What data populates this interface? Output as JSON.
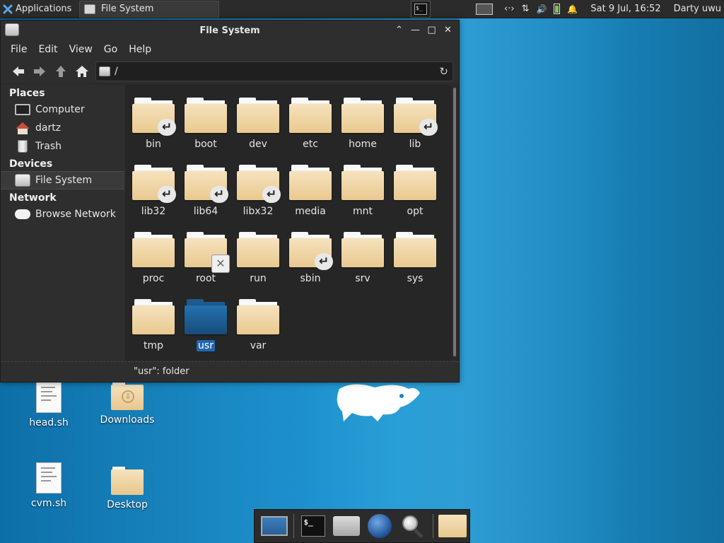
{
  "top_panel": {
    "applications_label": "Applications",
    "task_title": "File System",
    "term_launcher_text": "$_",
    "tray_network": "‹·›",
    "tray_transfer": "⇅",
    "tray_volume": "🔊",
    "tray_battery": "▮",
    "tray_bell": "🔔",
    "clock": "Sat  9 Jul, 16:52",
    "user": "Darty uwu"
  },
  "window": {
    "title": "File System",
    "controls": {
      "shade": "⌃",
      "minimize": "—",
      "maximize": "□",
      "close": "✕"
    },
    "menu": {
      "file": "File",
      "edit": "Edit",
      "view": "View",
      "go": "Go",
      "help": "Help"
    },
    "toolbar": {
      "back": "🡐",
      "forward": "🡒",
      "up": "🡑",
      "home": "⌂"
    },
    "location": {
      "path": "/",
      "reload": "↻"
    },
    "sidebar": {
      "places_header": "Places",
      "places": [
        {
          "label": "Computer",
          "icon": "computer-icon"
        },
        {
          "label": "dartz",
          "icon": "home-icon"
        },
        {
          "label": "Trash",
          "icon": "trash-icon"
        }
      ],
      "devices_header": "Devices",
      "devices": [
        {
          "label": "File System",
          "icon": "drive-icon",
          "selected": true
        }
      ],
      "network_header": "Network",
      "network": [
        {
          "label": "Browse Network",
          "icon": "cloud-icon"
        }
      ]
    },
    "files": [
      {
        "name": "bin",
        "badge": "link"
      },
      {
        "name": "boot",
        "badge": ""
      },
      {
        "name": "dev",
        "badge": ""
      },
      {
        "name": "etc",
        "badge": ""
      },
      {
        "name": "home",
        "badge": ""
      },
      {
        "name": "lib",
        "badge": "link"
      },
      {
        "name": "lib32",
        "badge": "link"
      },
      {
        "name": "lib64",
        "badge": "link"
      },
      {
        "name": "libx32",
        "badge": "link"
      },
      {
        "name": "media",
        "badge": ""
      },
      {
        "name": "mnt",
        "badge": ""
      },
      {
        "name": "opt",
        "badge": ""
      },
      {
        "name": "proc",
        "badge": ""
      },
      {
        "name": "root",
        "badge": "locked"
      },
      {
        "name": "run",
        "badge": ""
      },
      {
        "name": "sbin",
        "badge": "link"
      },
      {
        "name": "srv",
        "badge": ""
      },
      {
        "name": "sys",
        "badge": ""
      },
      {
        "name": "tmp",
        "badge": ""
      },
      {
        "name": "usr",
        "badge": "",
        "selected": true
      },
      {
        "name": "var",
        "badge": ""
      }
    ],
    "link_glyph": "↵",
    "locked_glyph": "✕",
    "status": "\"usr\": folder"
  },
  "desktop": {
    "icons": [
      {
        "label": "head.sh",
        "kind": "script"
      },
      {
        "label": "Downloads",
        "kind": "folder"
      },
      {
        "label": "cvm.sh",
        "kind": "script"
      },
      {
        "label": "Desktop",
        "kind": "folder"
      }
    ],
    "download_glyph": "⇩"
  },
  "dock": {
    "items": [
      "show-desktop",
      "terminal",
      "home-folder",
      "web-browser",
      "app-finder",
      "file-manager"
    ],
    "terminal_text": "$_"
  },
  "colors": {
    "selection": "#2067b0",
    "folder": "#f0d5a6",
    "panel": "#2b2b2b"
  }
}
